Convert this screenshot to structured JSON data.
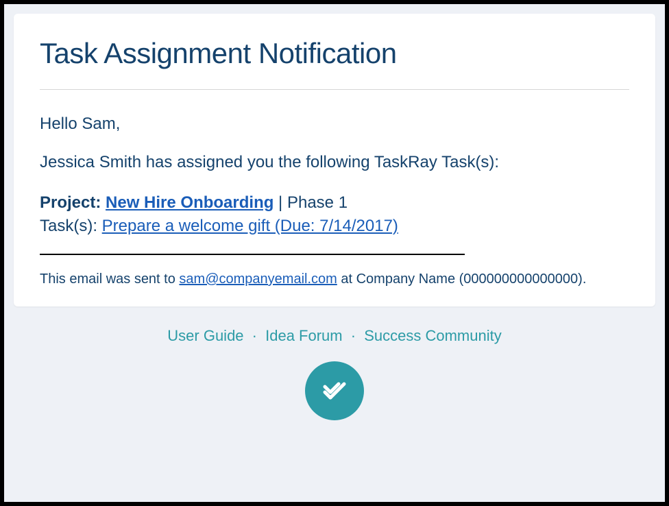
{
  "title": "Task Assignment Notification",
  "greeting": "Hello Sam,",
  "assignLine": "Jessica Smith has assigned you the following TaskRay Task(s):",
  "projectLabel": "Project:",
  "projectLink": "New Hire Onboarding",
  "phaseSeparator": " | ",
  "phase": "Phase 1",
  "tasksLabel": "Task(s): ",
  "taskLink": "Prepare a welcome gift (Due: 7/14/2017)",
  "sentPrefix": "This email was sent to ",
  "sentEmail": "sam@companyemail.com",
  "sentSuffix": " at Company Name (000000000000000).",
  "footer": {
    "userGuide": "User Guide",
    "ideaForum": "Idea Forum",
    "successCommunity": "Success Community"
  }
}
